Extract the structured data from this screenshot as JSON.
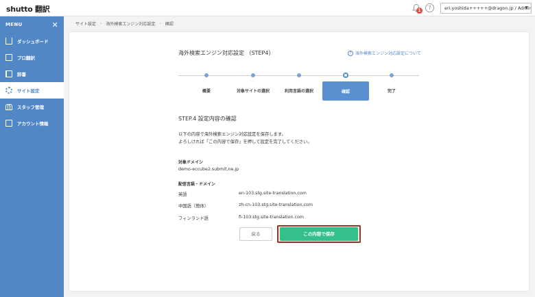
{
  "header": {
    "logo": "shutto 翻訳",
    "notification_count": "1",
    "help_symbol": "?",
    "user_label": "eri.yoshida+++++@dragon.jp / Admin"
  },
  "sidebar": {
    "menu_label": "MENU",
    "items": [
      {
        "label": "ダッシュボード",
        "icon": "house-icon"
      },
      {
        "label": "プロ翻訳",
        "icon": "document-icon"
      },
      {
        "label": "辞書",
        "icon": "book-icon"
      },
      {
        "label": "サイト設定",
        "icon": "gear-icon",
        "active": true
      },
      {
        "label": "スタッフ管理",
        "icon": "team-icon"
      },
      {
        "label": "アカウント情報",
        "icon": "account-icon"
      }
    ]
  },
  "breadcrumb": [
    "サイト設定",
    "海外検索エンジン対応設定",
    "確認"
  ],
  "main": {
    "title": "海外検索エンジン対応設定 （STEP4）",
    "help_link": "海外検索エンジン対応設定について",
    "steps": [
      {
        "label": "概要"
      },
      {
        "label": "対象サイトの選択"
      },
      {
        "label": "利用言語の選択"
      },
      {
        "label": "確認",
        "current": true
      },
      {
        "label": "完了"
      }
    ],
    "section_title": "STEP.4 設定内容の確認",
    "description_line1": "以下の内容で海外検索エンジン対応設定を保存します。",
    "description_line2": "よろしければ「この内容で保存」を押して設定を完了してください。",
    "target_domain_label": "対象ドメイン",
    "target_domain": "demo-eccube2.submit.ne.jp",
    "lang_domain_label": "配信言語・ドメイン",
    "languages": [
      {
        "name": "英語",
        "domain": "en-103.stg.site-translation.com"
      },
      {
        "name": "中国語（簡体）",
        "domain": "zh-cn-103.stg.site-translation.com"
      },
      {
        "name": "フィンランド語",
        "domain": "fi-103.stg.site-translation.com"
      }
    ],
    "back_button": "戻る",
    "save_button": "この内容で保存"
  },
  "colors": {
    "sidebar": "#5186c7",
    "save_button": "#33c08a",
    "highlight_border": "#8b3a2f"
  }
}
